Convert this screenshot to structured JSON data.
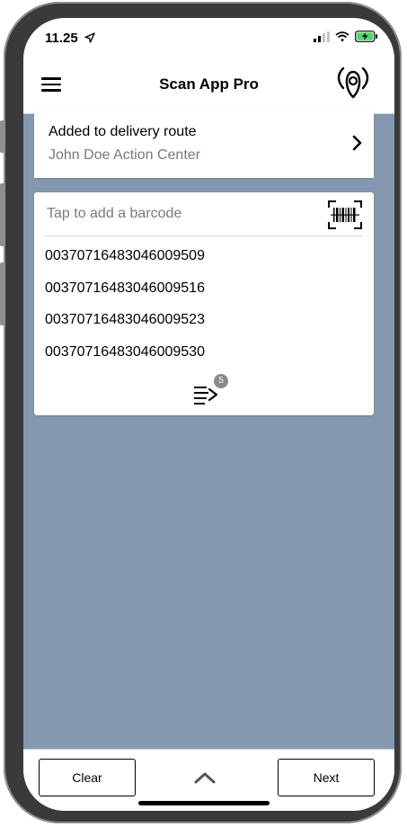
{
  "status_bar": {
    "time": "11.25",
    "icons": [
      "location-arrow-icon",
      "signal-icon",
      "wifi-icon",
      "battery-charging-icon"
    ]
  },
  "navbar": {
    "title": "Scan App Pro",
    "left_icon": "hamburger-menu-icon",
    "right_icon": "location-beacon-icon"
  },
  "route_card": {
    "title": "Added to delivery route",
    "subtitle": "John Doe Action Center",
    "icon": "chevron-right-icon"
  },
  "barcode_card": {
    "placeholder": "Tap to add a barcode",
    "value": "",
    "scan_icon": "barcode-scan-icon",
    "codes": [
      "00370716483046009509",
      "00370716483046009516",
      "00370716483046009523",
      "00370716483046009530"
    ],
    "list_icon": "list-send-icon",
    "badge_count": "5"
  },
  "bottom_bar": {
    "clear_label": "Clear",
    "next_label": "Next",
    "expand_icon": "chevron-up-icon"
  },
  "colors": {
    "background": "#8498b0",
    "card": "#ffffff",
    "text_primary": "#000000",
    "text_secondary": "#7a7a7a",
    "badge": "#8a8a8a"
  }
}
